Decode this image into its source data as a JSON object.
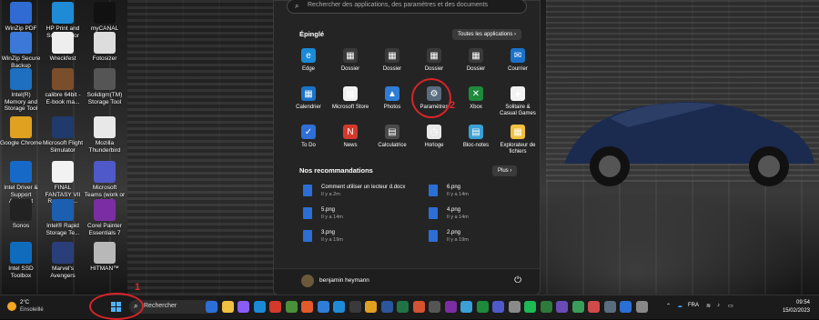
{
  "desktop": {
    "icons": [
      {
        "label": "WinZip PDF Express",
        "color": "#2f6bd3"
      },
      {
        "label": "HP Print and Scan Doctor",
        "color": "#1f8bd6"
      },
      {
        "label": "myCANAL",
        "color": "#111111"
      },
      {
        "label": "WinZip Secure Backup",
        "color": "#3b78d8"
      },
      {
        "label": "Wreckfest",
        "color": "#eeeeee"
      },
      {
        "label": "Fotosizer",
        "color": "#dddddd"
      },
      {
        "label": "Intel(R) Memory and Storage Tool",
        "color": "#1e6fc0"
      },
      {
        "label": "calibre 64bit - E-book ma...",
        "color": "#7a4e2b"
      },
      {
        "label": "Solidigm(TM) Storage Tool",
        "color": "#555555"
      },
      {
        "label": "Google Chrome",
        "color": "#e0a020"
      },
      {
        "label": "Microsoft Flight Simulator",
        "color": "#1f3a6b"
      },
      {
        "label": "Mozilla Thunderbird",
        "color": "#e8e8e8"
      },
      {
        "label": "Intel Driver & Support Assistant",
        "color": "#1769c7"
      },
      {
        "label": "FINAL FANTASY VII Remaster...",
        "color": "#f2f2f2"
      },
      {
        "label": "Microsoft Teams (work or school)",
        "color": "#5059c9"
      },
      {
        "label": "Sonos",
        "color": "#222222"
      },
      {
        "label": "Intel® Rapid Storage Te...",
        "color": "#1c5fb0"
      },
      {
        "label": "Corel Painter Essentials 7",
        "color": "#7b2ea3"
      },
      {
        "label": "Intel SSD Toolbox",
        "color": "#0f6cbd"
      },
      {
        "label": "Marvel's Avengers",
        "color": "#2a3f7a"
      },
      {
        "label": "HITMAN™",
        "color": "#b8b8b8"
      }
    ]
  },
  "start_menu": {
    "search_placeholder": "Rechercher des applications, des paramètres et des documents",
    "pinned_title": "Épinglé",
    "all_apps_label": "Toutes les applications",
    "pinned": [
      {
        "name": "Edge",
        "icon": "edge-icon",
        "color": "#1b8ad6"
      },
      {
        "name": "Dossier",
        "icon": "folder-icon",
        "color": "#3a3a3a"
      },
      {
        "name": "Dossier",
        "icon": "folder-icon",
        "color": "#3a3a3a"
      },
      {
        "name": "Dossier",
        "icon": "folder-icon",
        "color": "#3a3a3a"
      },
      {
        "name": "Dossier",
        "icon": "folder-icon",
        "color": "#3a3a3a"
      },
      {
        "name": "Courrier",
        "icon": "mail-icon",
        "color": "#1a73c9"
      },
      {
        "name": "Calendrier",
        "icon": "calendar-icon",
        "color": "#1a73c9"
      },
      {
        "name": "Microsoft Store",
        "icon": "store-icon",
        "color": "#f2f2f2"
      },
      {
        "name": "Photos",
        "icon": "photos-icon",
        "color": "#2e7dd7"
      },
      {
        "name": "Paramètres",
        "icon": "gear-icon",
        "color": "#5a6c80"
      },
      {
        "name": "Xbox",
        "icon": "xbox-icon",
        "color": "#1e8a3c"
      },
      {
        "name": "Solitaire & Casual Games",
        "icon": "cards-icon",
        "color": "#f2f2f2"
      },
      {
        "name": "To Do",
        "icon": "checkmark-icon",
        "color": "#2f6fd6"
      },
      {
        "name": "News",
        "icon": "news-icon",
        "color": "#d33a2c"
      },
      {
        "name": "Calculatrice",
        "icon": "calculator-icon",
        "color": "#4a4a4a"
      },
      {
        "name": "Horloge",
        "icon": "clock-icon",
        "color": "#e8e8e8"
      },
      {
        "name": "Bloc-notes",
        "icon": "notepad-icon",
        "color": "#3aa0d6"
      },
      {
        "name": "Explorateur de fichiers",
        "icon": "folder-icon",
        "color": "#f0c040"
      }
    ],
    "rec_title": "Nos recommandations",
    "more_label": "Plus",
    "recommendations": [
      {
        "name": "Comment utiliser un lecteur d.docx",
        "time": "Il y a 2m"
      },
      {
        "name": "6.png",
        "time": "Il y a 14m"
      },
      {
        "name": "5.png",
        "time": "Il y a 14m"
      },
      {
        "name": "4.png",
        "time": "Il y a 14m"
      },
      {
        "name": "3.png",
        "time": "Il y a 19m"
      },
      {
        "name": "2.png",
        "time": "Il y a 19m"
      }
    ],
    "user_name": "benjamin heymann"
  },
  "taskbar": {
    "weather_temp": "2°C",
    "weather_cond": "Ensoleillé",
    "search_label": "Rechercher",
    "language": "FRA",
    "time": "09:54",
    "date": "15/02/2023",
    "apps": [
      "#2b6fd6",
      "#f0c040",
      "#8a5cf6",
      "#1b8ad6",
      "#d33a2c",
      "#4a8f3a",
      "#e05a2b",
      "#2e7dd7",
      "#1f8bd6",
      "#3a3a3a",
      "#e0a020",
      "#2b579a",
      "#217346",
      "#d35230",
      "#555555",
      "#7b2ea3",
      "#3aa0d6",
      "#1e8a3c",
      "#5059c9",
      "#8a8a8a",
      "#1db954",
      "#2d7a3a",
      "#6a4bb5",
      "#3a9e5a",
      "#d04a4a",
      "#5a6c80",
      "#2b6fd6",
      "#888888"
    ]
  },
  "annotations": {
    "step1": "1",
    "step2": "2"
  }
}
